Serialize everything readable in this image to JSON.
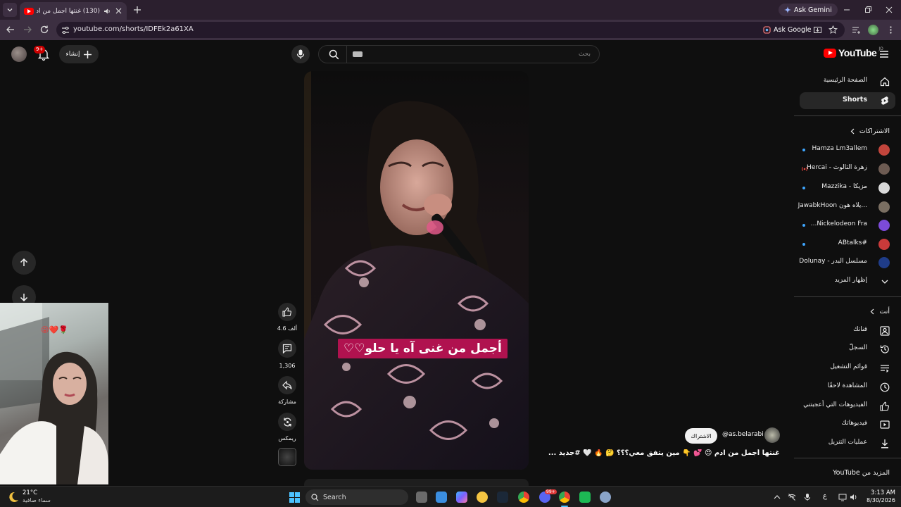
{
  "browser": {
    "tab": {
      "title": "(130) غنتها أجمل من آدم 😍 💕"
    },
    "new_tab_label": "+",
    "ask_gemini": "Ask Gemini",
    "url": "youtube.com/shorts/IDFEk2a61XA",
    "ask_google": "Ask Google"
  },
  "header": {
    "notifications_badge": "9+",
    "create_label": "إنشاء",
    "search_placeholder": "بحث",
    "logo_text": "YouTube",
    "logo_region": "JO"
  },
  "sidebar": {
    "primary": [
      {
        "label": "الصفحة الرئيسية",
        "icon": "home-icon"
      },
      {
        "label": "Shorts",
        "icon": "shorts-icon",
        "active": true
      }
    ],
    "subscriptions_heading": "الاشتراكات",
    "subscriptions": [
      {
        "label": "Hamza Lm3allem",
        "color": "#c2453c",
        "badge": "dot"
      },
      {
        "label": "زهرة الثالوث - Hercai",
        "color": "#6d5b52",
        "badge": "live"
      },
      {
        "label": "مزيكا - Mazzika",
        "color": "#d9d9d9",
        "badge": "dot"
      },
      {
        "label": "...يلاه هون JawabkHoon",
        "color": "#7a6f62",
        "badge": "none"
      },
      {
        "label": "Nickelodeon Fra...",
        "color": "#7c4bd8",
        "badge": "dot"
      },
      {
        "label": "#ABtalks",
        "color": "#c93a3a",
        "badge": "dot"
      },
      {
        "label": "مسلسل البدر - Dolunay",
        "color": "#1f3c88",
        "badge": "none"
      }
    ],
    "show_more": "إظهار المزيد",
    "you_heading": "أنت",
    "you_items": [
      {
        "label": "قناتك",
        "icon": "your-channel-icon"
      },
      {
        "label": "السجلّ",
        "icon": "history-icon"
      },
      {
        "label": "قوائم التشغيل",
        "icon": "playlists-icon"
      },
      {
        "label": "المشاهدة لاحقًا",
        "icon": "watch-later-icon"
      },
      {
        "label": "الفيديوهات التي أعجبتني",
        "icon": "liked-videos-icon"
      },
      {
        "label": "فيديوهاتك",
        "icon": "your-videos-icon"
      },
      {
        "label": "عمليات التنزيل",
        "icon": "downloads-icon"
      }
    ],
    "more_from_youtube": "المزيد من YouTube"
  },
  "short": {
    "caption": "أجمل من غنى آه يا حلو♡♡",
    "likes": "4.6 ألف",
    "comments": "1,306",
    "share_label": "مشاركة",
    "remix_label": "ريمكس",
    "channel": "@as.belarabi",
    "subscribe": "الاشتراك",
    "description": "غنتها أجمل من آدم 😍 💕 👇 مين يتفق معي؟؟؟ 🤔 🔥 🤍 #جديد ..."
  },
  "webcam": {
    "emoji": "😜❤️🌹"
  },
  "taskbar": {
    "temperature": "21°C",
    "weather": "سماء صافية",
    "search": "Search",
    "discord_badge": "99+",
    "lang": "ع",
    "time": "3:13 AM",
    "date": "8/30/2026"
  },
  "colors": {
    "accent": "#ff0000",
    "caption_bg": "#b0124f",
    "link_blue": "#3ea6ff",
    "browser_frame": "#3c2f41"
  }
}
